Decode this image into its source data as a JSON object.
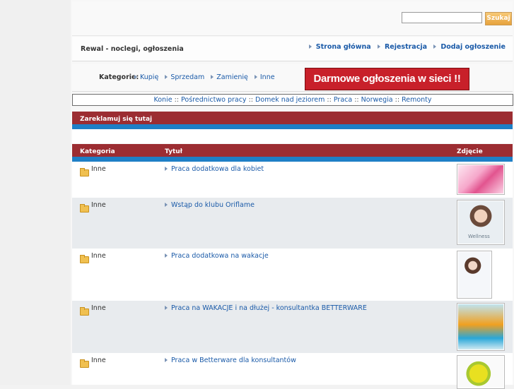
{
  "search": {
    "value": "",
    "button_label": "Szukaj"
  },
  "site_title": "Rewal - noclegi, ogłoszenia",
  "top_nav": [
    "Strona główna",
    "Rejestracja",
    "Dodaj ogłoszenie"
  ],
  "categories": {
    "label": "Kategorie:",
    "items": [
      "Kupię",
      "Sprzedam",
      "Zamienię",
      "Inne"
    ]
  },
  "banner_text": "Darmowe ogłoszenia w sieci !!",
  "quick_links": [
    "Konie",
    "Pośrednictwo pracy",
    "Domek nad jeziorem",
    "Praca",
    "Norwegia",
    "Remonty"
  ],
  "quick_links_separator": "::",
  "promo_heading": "Zareklamuj się tutaj",
  "table": {
    "headers": {
      "category": "Kategoria",
      "title": "Tytuł",
      "photo": "Zdjęcie"
    },
    "rows": [
      {
        "category": "Inne",
        "title": "Praca dodatkowa dla kobiet",
        "photo": "pink-flowers-photo"
      },
      {
        "category": "Inne",
        "title": "Wstąp do klubu Oriflame",
        "photo": "wellness-woman-photo",
        "photo_caption": "Wellness"
      },
      {
        "category": "Inne",
        "title": "Praca dodatkowa na wakacje",
        "photo": "smiling-woman-photo"
      },
      {
        "category": "Inne",
        "title": "Praca na WAKACJE i na dłużej - konsultantka BETTERWARE",
        "photo": "containers-photo"
      },
      {
        "category": "Inne",
        "title": "Praca w Betterware dla konsultantów",
        "photo": "lemon-squeezer-photo"
      }
    ]
  },
  "colors": {
    "header_red": "#9c2d32",
    "accent_blue": "#1e7fc6",
    "link_blue": "#1a5aa8",
    "banner_red": "#c8202a"
  }
}
